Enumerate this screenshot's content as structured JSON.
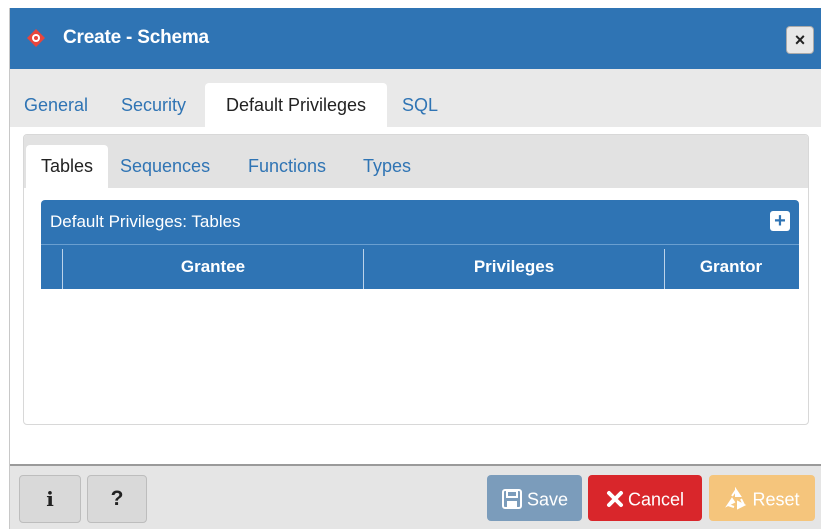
{
  "dialog": {
    "title": "Create - Schema",
    "close_symbol": "×",
    "app_icon": "pgadmin-diamond-icon"
  },
  "main_tabs": [
    {
      "label": "General",
      "active": false
    },
    {
      "label": "Security",
      "active": false
    },
    {
      "label": "Default Privileges",
      "active": true
    },
    {
      "label": "SQL",
      "active": false
    }
  ],
  "sub_tabs": [
    {
      "label": "Tables",
      "active": true
    },
    {
      "label": "Sequences",
      "active": false
    },
    {
      "label": "Functions",
      "active": false
    },
    {
      "label": "Types",
      "active": false
    }
  ],
  "grid": {
    "title": "Default Privileges: Tables",
    "add_symbol": "+",
    "columns": [
      "Grantee",
      "Privileges",
      "Grantor"
    ],
    "rows": []
  },
  "footer": {
    "info_label": "i",
    "help_label": "?",
    "save_label": "Save",
    "cancel_label": "Cancel",
    "reset_label": "Reset"
  },
  "colors": {
    "primary": "#2f74b4",
    "save": "#7b9cbb",
    "cancel": "#d9262b",
    "reset": "#f5c57c"
  }
}
